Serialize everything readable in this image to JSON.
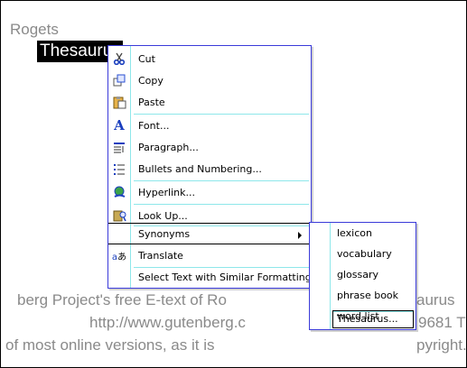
{
  "document": {
    "line1": "Rogets",
    "selected_text": "Thesaurus",
    "line_a": "berg Project's free E-text of Ro",
    "line_a_tail": "aurus",
    "line_b": "http://www.gutenberg.c",
    "line_b_tail": "9681 T",
    "line_c": "of most online versions, as it is",
    "line_c_tail": "pyright."
  },
  "context_menu": {
    "items": [
      {
        "label": "Cut",
        "icon": "scissors-icon"
      },
      {
        "label": "Copy",
        "icon": "copy-icon"
      },
      {
        "label": "Paste",
        "icon": "paste-icon"
      },
      {
        "label": "Font...",
        "icon": "font-icon"
      },
      {
        "label": "Paragraph...",
        "icon": "paragraph-icon"
      },
      {
        "label": "Bullets and Numbering...",
        "icon": "bullets-icon"
      },
      {
        "label": "Hyperlink...",
        "icon": "hyperlink-icon"
      },
      {
        "label": "Look Up...",
        "icon": "lookup-icon"
      },
      {
        "label": "Synonyms",
        "icon": ""
      },
      {
        "label": "Translate",
        "icon": "translate-icon"
      },
      {
        "label": "Select Text with Similar Formatting",
        "icon": ""
      }
    ]
  },
  "synonyms_submenu": {
    "items": [
      "lexicon",
      "vocabulary",
      "glossary",
      "phrase book",
      "word list",
      "Thesaurus..."
    ]
  }
}
